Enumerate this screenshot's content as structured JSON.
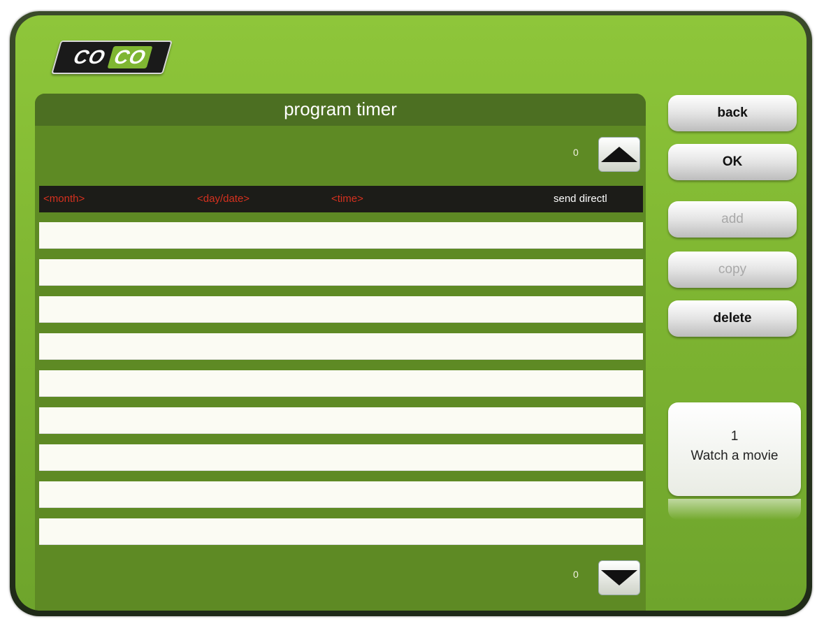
{
  "logo": {
    "part1": "CO",
    "part2": "CO"
  },
  "panel": {
    "title": "program timer"
  },
  "scroll": {
    "top_count": "0",
    "bottom_count": "0"
  },
  "table": {
    "headers": [
      "<month>",
      "<day/date>",
      "<time>",
      "send directl"
    ],
    "rows": [
      "",
      "",
      "",
      "",
      "",
      "",
      "",
      "",
      ""
    ]
  },
  "buttons": {
    "back": "back",
    "ok": "OK",
    "add": "add",
    "copy": "copy",
    "delete": "delete"
  },
  "channel": {
    "number": "1",
    "name": "Watch a movie"
  },
  "icons": {
    "scroll_up": "triangle-up-icon",
    "scroll_down": "triangle-down-icon"
  }
}
